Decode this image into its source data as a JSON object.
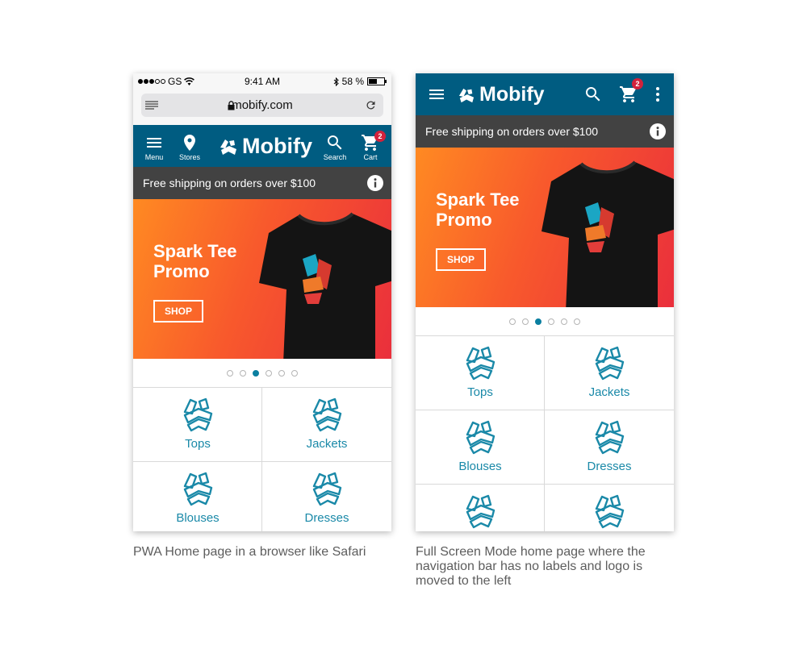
{
  "colors": {
    "brand_blue": "#005c81",
    "banner_dark": "#424242",
    "badge_red": "#d2223c",
    "accent_teal": "#1a89a8"
  },
  "left_screen": {
    "status_bar": {
      "carrier": "GS",
      "time": "9:41 AM",
      "battery": "58 %",
      "battery_level": 0.58
    },
    "browser": {
      "url": "mobify.com"
    },
    "header": {
      "menu_label": "Menu",
      "stores_label": "Stores",
      "logo_text": "Mobify",
      "search_label": "Search",
      "cart_label": "Cart",
      "cart_count": "2"
    },
    "shipping_banner": "Free shipping on orders over $100",
    "hero": {
      "title_line1": "Spark Tee",
      "title_line2": "Promo",
      "button": "SHOP"
    },
    "carousel": {
      "total": 6,
      "active_index": 2
    },
    "categories": [
      "Tops",
      "Jackets",
      "Blouses",
      "Dresses"
    ]
  },
  "right_screen": {
    "header": {
      "logo_text": "Mobify",
      "cart_count": "2"
    },
    "shipping_banner": "Free shipping on orders over $100",
    "hero": {
      "title_line1": "Spark Tee",
      "title_line2": "Promo",
      "button": "SHOP"
    },
    "carousel": {
      "total": 6,
      "active_index": 2
    },
    "categories": [
      "Tops",
      "Jackets",
      "Blouses",
      "Dresses",
      "",
      ""
    ]
  },
  "captions": {
    "left": "PWA Home page in a browser like Safari",
    "right": "Full Screen Mode home page where the navigation bar has no labels and logo is moved to the left"
  }
}
